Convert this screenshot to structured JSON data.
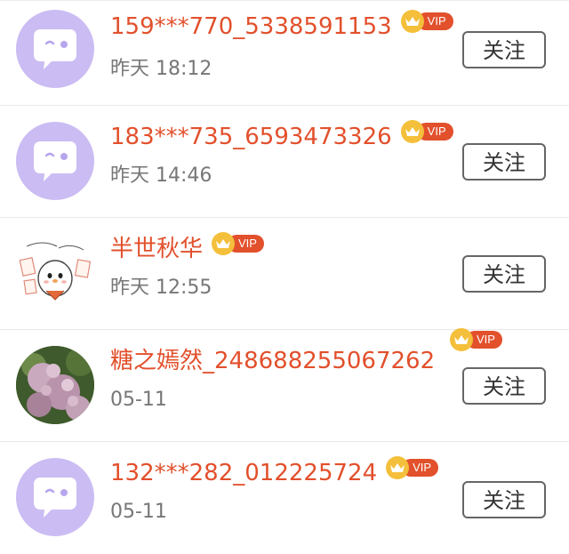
{
  "items": [
    {
      "name": "159***770_5338591153",
      "subtext": "昨天 18:12",
      "vip": "VIP",
      "follow": "关注",
      "avatar": "default-chat-avatar"
    },
    {
      "name": "183***735_6593473326",
      "subtext": "昨天 14:46",
      "vip": "VIP",
      "follow": "关注",
      "avatar": "default-chat-avatar"
    },
    {
      "name": "半世秋华",
      "subtext": "昨天 12:55",
      "vip": "VIP",
      "follow": "关注",
      "avatar": "cartoon-avatar"
    },
    {
      "name": "糖之嫣然_248688255067262",
      "subtext": "05-11",
      "vip": "VIP",
      "follow": "关注",
      "avatar": "flower-photo-avatar"
    },
    {
      "name": "132***282_012225724",
      "subtext": "05-11",
      "vip": "VIP",
      "follow": "关注",
      "avatar": "default-chat-avatar"
    }
  ],
  "colors": {
    "name": "#e2502c",
    "vip_badge": "#e2502c",
    "vip_crown": "#f4bf3a",
    "default_avatar": "#cbbcf3",
    "subtext": "#777777",
    "button_border": "#666666"
  }
}
